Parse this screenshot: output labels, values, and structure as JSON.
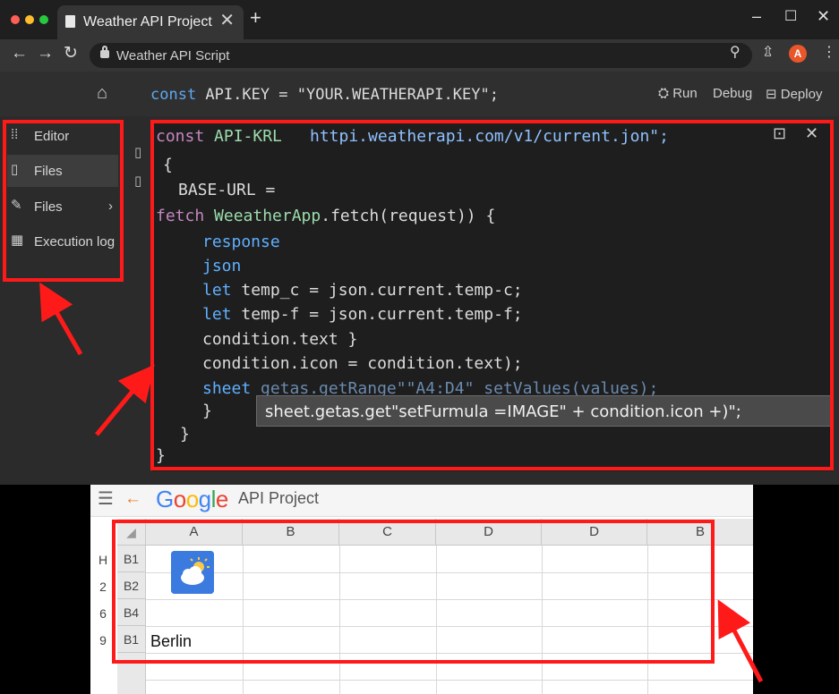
{
  "browser": {
    "tab_title": "Weather API Project",
    "tab_close": "✕",
    "new_tab": "+",
    "address": "Weather API Script",
    "window_controls": {
      "minimize": "–",
      "maximize": "☐",
      "close": "✕"
    },
    "nav": {
      "back": "←",
      "forward": "→",
      "reload": "↻"
    },
    "extensions": [
      "⚲",
      "⇫",
      "⋮"
    ],
    "profile_initial": "A",
    "colors": {
      "dot_red": "#ff5f57",
      "dot_yellow": "#febc2e",
      "dot_green": "#28c840",
      "profile": "#e8562a"
    }
  },
  "editor": {
    "home_icon": "⌂",
    "top_line": {
      "keyword": "const",
      "text": " API.KEY = \"YOUR.WEATHERAPI.KEY\";"
    },
    "toolbar": {
      "run": "Run",
      "debug": "Debug",
      "deploy": "Deploy"
    },
    "sidebar": [
      {
        "icon": "grid-icon",
        "glyph": "⁞⁞",
        "label": "Editor"
      },
      {
        "icon": "file-icon",
        "glyph": "▯",
        "label": "Files"
      },
      {
        "icon": "pencil-icon",
        "glyph": "✎",
        "label": "Files",
        "chevron": "›"
      },
      {
        "icon": "table-icon",
        "glyph": "▦",
        "label": "Execution log"
      }
    ],
    "code_tools": {
      "expand": "⊡",
      "close": "✕"
    },
    "code_lines": [
      {
        "kw": "const",
        "name": " API-KRL",
        "str": "httpi.weatherapi.com/v1/current.jon\";"
      },
      {
        "text": "{"
      },
      {
        "text": "BASE-URL ="
      },
      {
        "kw": "fetch",
        "name": " WeeatherApp",
        "rest": ".fetch(request)) {"
      },
      {
        "fn": "response"
      },
      {
        "fn": "json"
      },
      {
        "kw": "let",
        "rest": " temp_c = json.current.temp-c;"
      },
      {
        "kw": "let",
        "rest": " temp-f = json.current.temp-f;"
      },
      {
        "text": "condition.text }"
      },
      {
        "text": "condition.icon = condition.text);"
      },
      {
        "fn": "sheet",
        "rest": " getas.getRange\"\"A4:D4\" setValues(values);"
      },
      {
        "text": "}"
      },
      {
        "text": "}"
      },
      {
        "text": "}"
      }
    ],
    "tooltip": "sheet.getas.get\"setFurmula =IMAGE\" + condition.icon +)\";"
  },
  "sheets": {
    "menu_icon": "☰",
    "back_icon": "←",
    "logo": [
      "G",
      "o",
      "o",
      "g",
      "l",
      "e"
    ],
    "logo_colors": [
      "#4285f4",
      "#ea4335",
      "#fbbc05",
      "#4285f4",
      "#34a853",
      "#ea4335"
    ],
    "title": "API Project",
    "corner": "◢",
    "columns": [
      "A",
      "B",
      "C",
      "D",
      "D",
      "B"
    ],
    "rows": [
      {
        "num": "H",
        "head": "B1",
        "a": ""
      },
      {
        "num": "2",
        "head": "B2",
        "a": ""
      },
      {
        "num": "6",
        "head": "B4",
        "a": ""
      },
      {
        "num": "9",
        "head": "B1",
        "a": "Berlin"
      }
    ]
  },
  "annotations": {
    "highlight_color": "#ff1a1a"
  }
}
